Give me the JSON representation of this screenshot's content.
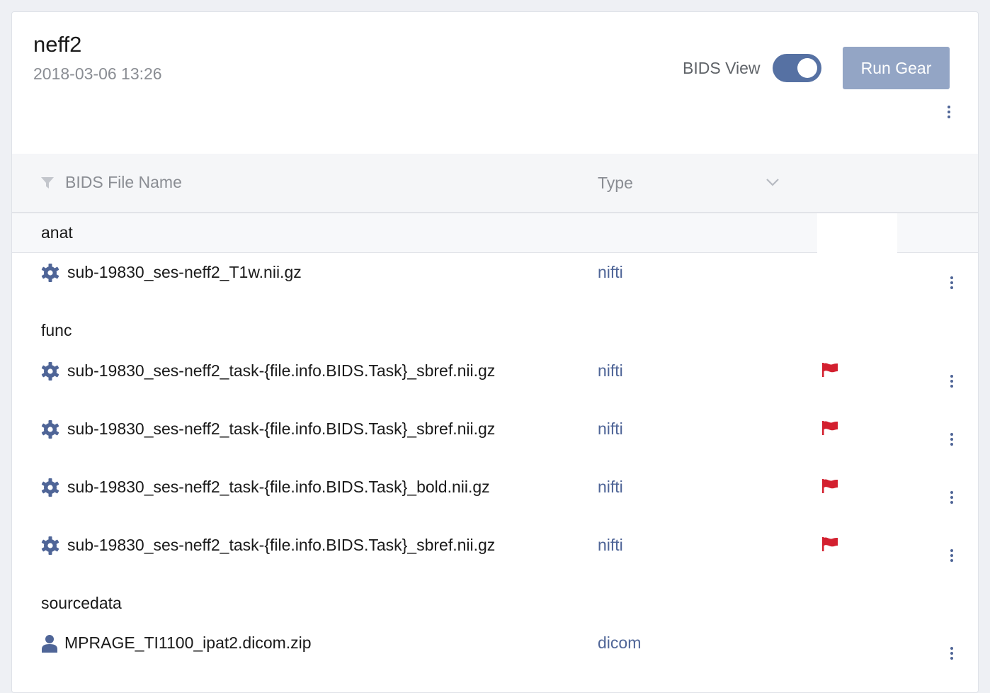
{
  "session": {
    "title": "neff2",
    "timestamp": "2018-03-06 13:26"
  },
  "header": {
    "bids_view_label": "BIDS View",
    "bids_view_on": true,
    "run_gear_label": "Run Gear"
  },
  "table": {
    "columns": {
      "name": "BIDS File Name",
      "type": "Type"
    },
    "groups": [
      {
        "label": "anat",
        "files": [
          {
            "name": "sub-19830_ses-neff2_T1w.nii.gz",
            "type": "nifti",
            "icon": "gear-icon",
            "flagged": false
          }
        ]
      },
      {
        "label": "func",
        "files": [
          {
            "name": "sub-19830_ses-neff2_task-{file.info.BIDS.Task}_sbref.nii.gz",
            "type": "nifti",
            "icon": "gear-icon",
            "flagged": true
          },
          {
            "name": "sub-19830_ses-neff2_task-{file.info.BIDS.Task}_sbref.nii.gz",
            "type": "nifti",
            "icon": "gear-icon",
            "flagged": true
          },
          {
            "name": "sub-19830_ses-neff2_task-{file.info.BIDS.Task}_bold.nii.gz",
            "type": "nifti",
            "icon": "gear-icon",
            "flagged": true
          },
          {
            "name": "sub-19830_ses-neff2_task-{file.info.BIDS.Task}_sbref.nii.gz",
            "type": "nifti",
            "icon": "gear-icon",
            "flagged": true
          }
        ]
      },
      {
        "label": "sourcedata",
        "files": [
          {
            "name": "MPRAGE_TI1100_ipat2.dicom.zip",
            "type": "dicom",
            "icon": "user-icon",
            "flagged": false
          }
        ]
      }
    ]
  },
  "colors": {
    "accent": "#4f6597",
    "toggle_on": "#5671a3",
    "button_disabled": "#93a5c5",
    "flag": "#d3202f"
  }
}
